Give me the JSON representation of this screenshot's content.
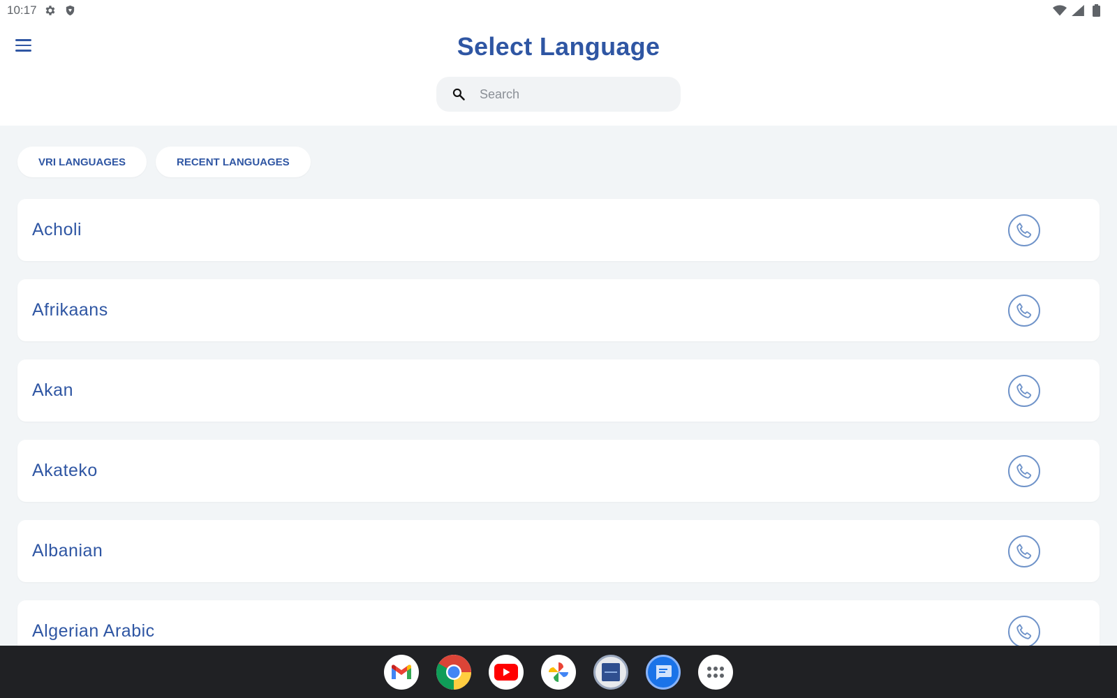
{
  "status_bar": {
    "time": "10:17",
    "left_icons": [
      "gear-icon",
      "shield-icon"
    ],
    "right_icons": [
      "wifi-icon",
      "signal-icon",
      "battery-icon"
    ]
  },
  "header": {
    "title": "Select Language",
    "search": {
      "placeholder": "Search",
      "value": ""
    }
  },
  "filters": [
    {
      "label": "VRI LANGUAGES"
    },
    {
      "label": "RECENT LANGUAGES"
    }
  ],
  "languages": [
    {
      "name": "Acholi"
    },
    {
      "name": "Afrikaans"
    },
    {
      "name": "Akan"
    },
    {
      "name": "Akateko"
    },
    {
      "name": "Albanian"
    },
    {
      "name": "Algerian Arabic"
    }
  ],
  "dock": {
    "apps": [
      "gmail-icon",
      "chrome-icon",
      "youtube-icon",
      "photos-icon",
      "interpreter-app-icon",
      "messages-icon",
      "app-drawer-icon"
    ]
  },
  "colors": {
    "primary": "#2f56a3",
    "accent_outline": "#6f93c9",
    "content_bg": "#f2f5f7",
    "dock_bg": "#202124"
  }
}
